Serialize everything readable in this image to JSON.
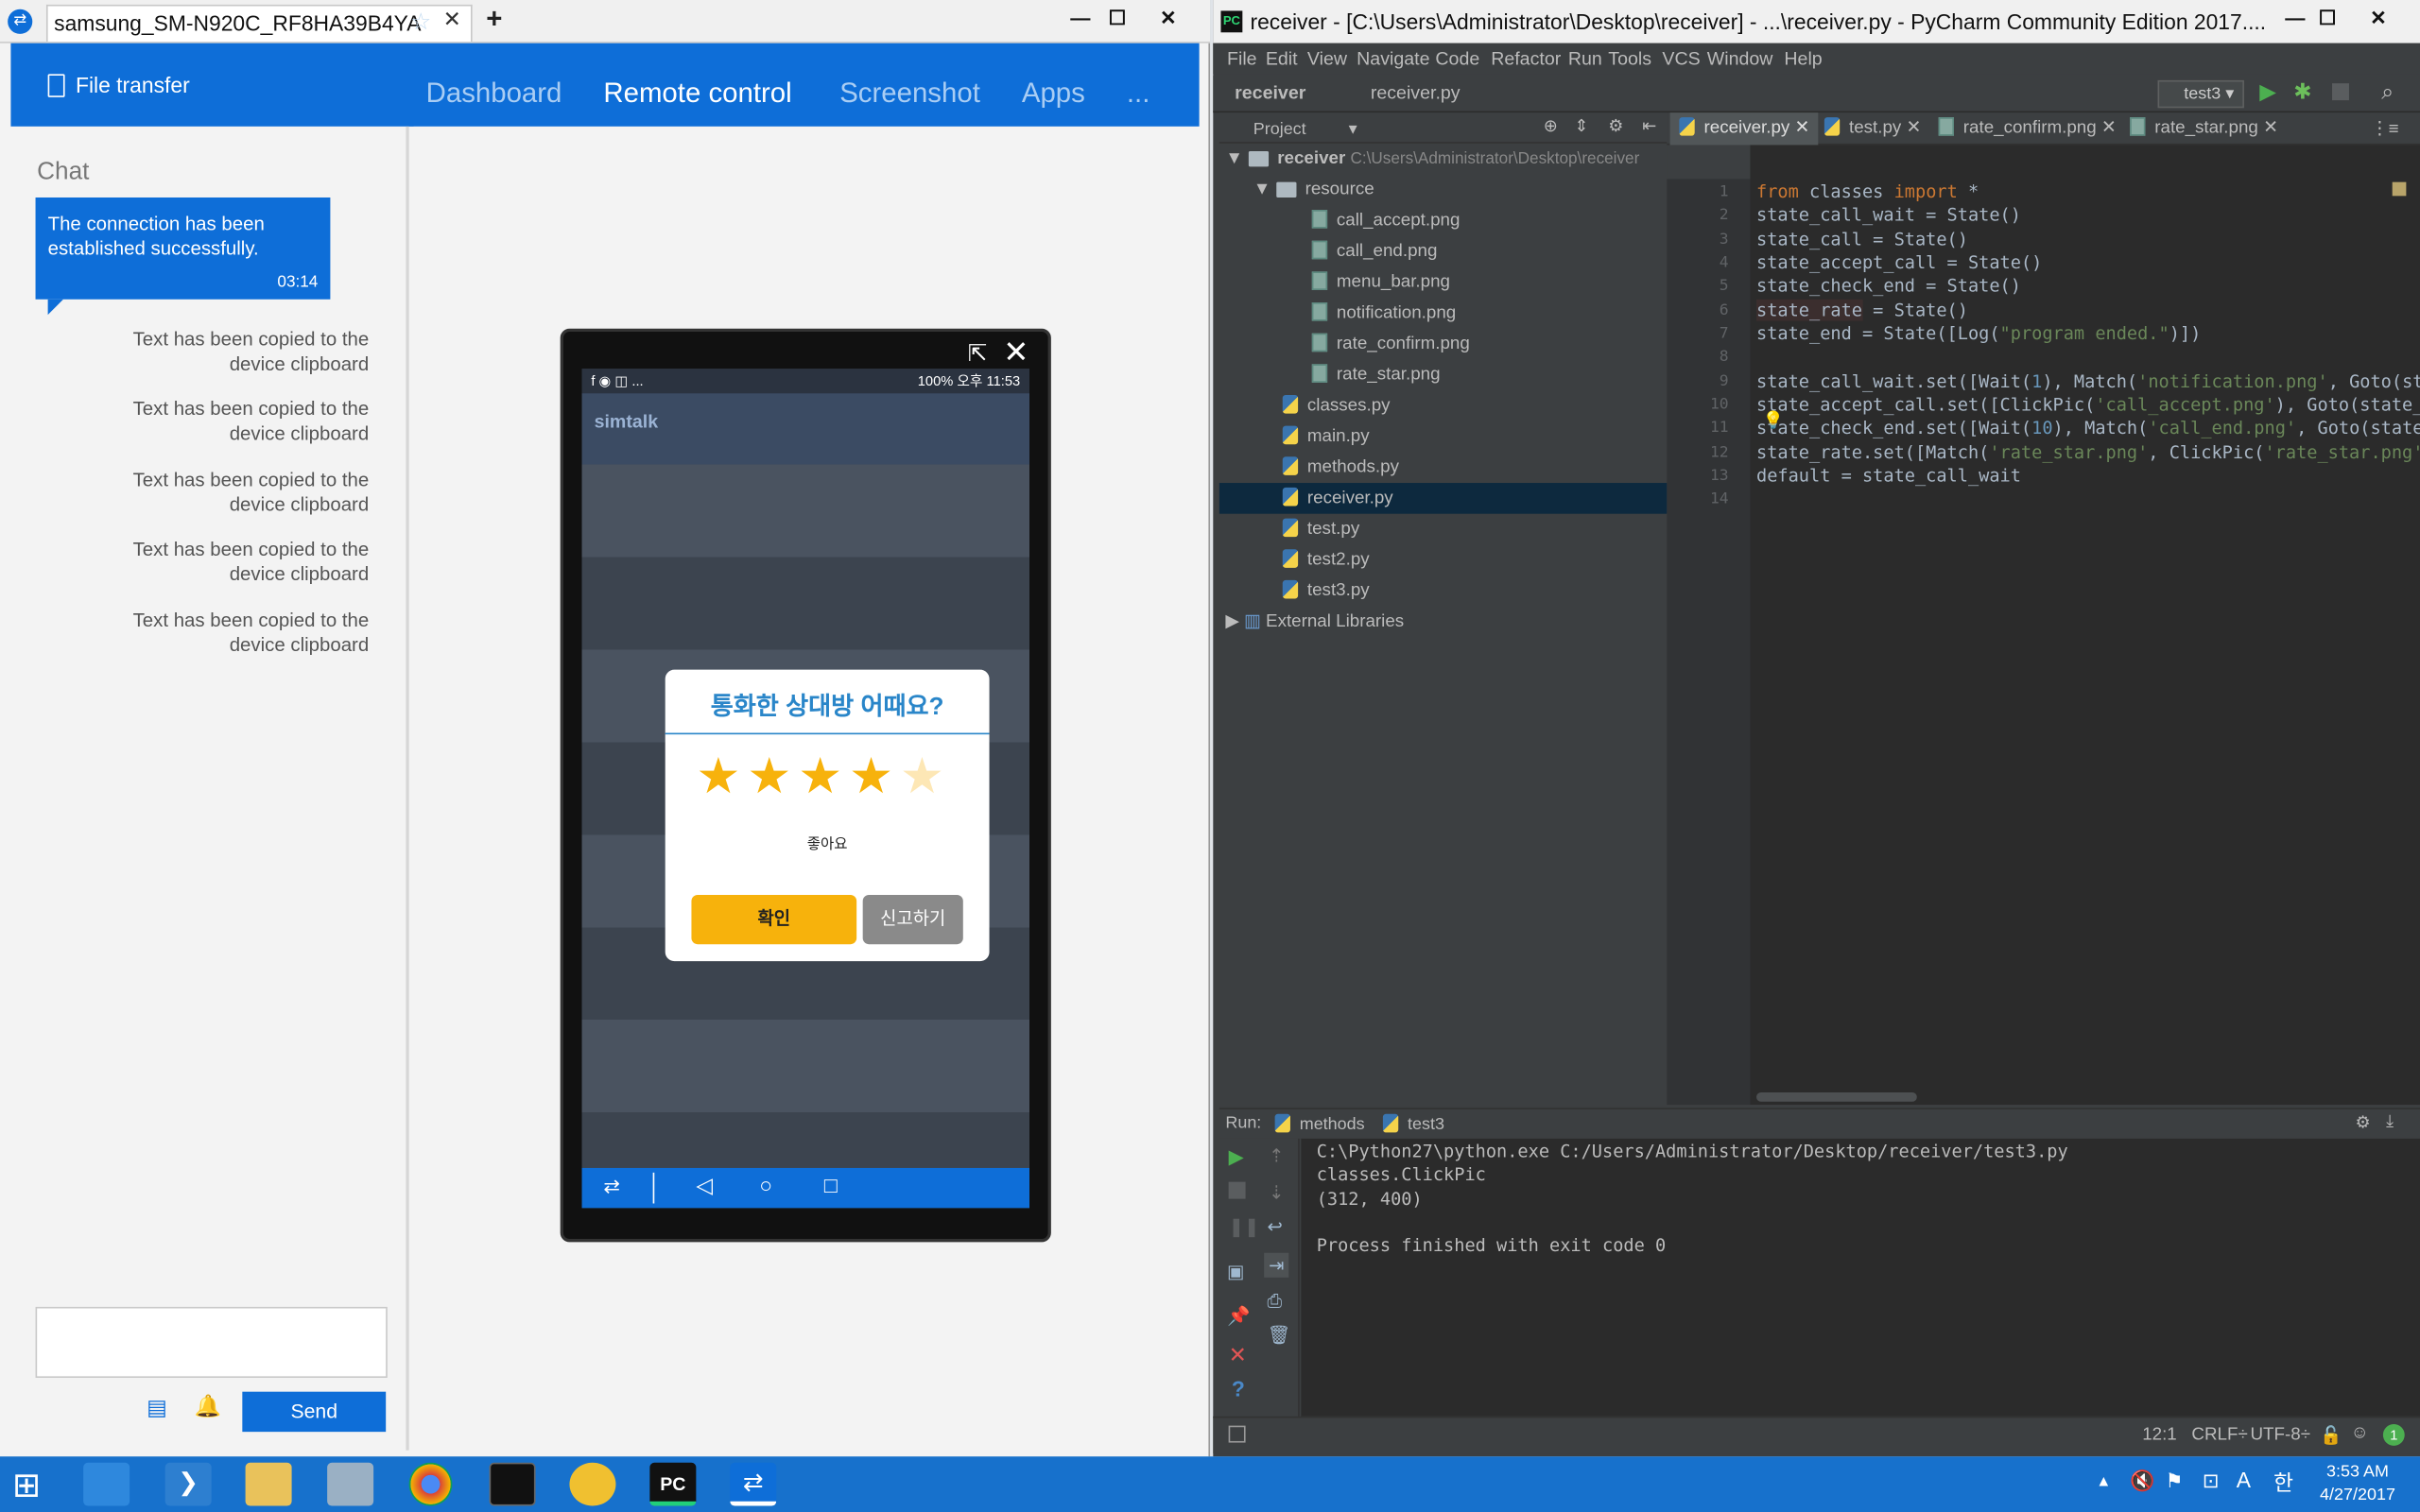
{
  "teamviewer": {
    "tab_title": "samsung_SM-N920C_RF8HA39B4YA",
    "header": {
      "file_transfer": "File transfer",
      "nav": [
        "Dashboard",
        "Remote control",
        "Screenshot",
        "Apps",
        "..."
      ]
    },
    "chat": {
      "title": "Chat",
      "bubble_text": "The connection has been established successfully.",
      "bubble_time": "03:14",
      "system_messages": [
        "Text has been copied to the device clipboard",
        "Text has been copied to the device clipboard",
        "Text has been copied to the device clipboard",
        "Text has been copied to the device clipboard",
        "Text has been copied to the device clipboard"
      ],
      "input_value": "",
      "send_label": "Send"
    },
    "phone": {
      "status_left": "f ◉ ◫ ...",
      "status_right": "100% 오후 11:53",
      "app_logo": "simtalk",
      "dialog": {
        "title": "통화한 상대방 어때요?",
        "rating": 4,
        "max_rating": 5,
        "rating_label": "좋아요",
        "confirm_label": "확인",
        "report_label": "신고하기"
      }
    }
  },
  "pycharm": {
    "title": "receiver - [C:\\Users\\Administrator\\Desktop\\receiver] - ...\\receiver.py - PyCharm Community Edition 2017....",
    "menu": [
      "File",
      "Edit",
      "View",
      "Navigate",
      "Code",
      "Refactor",
      "Run",
      "Tools",
      "VCS",
      "Window",
      "Help"
    ],
    "breadcrumb": [
      "receiver",
      "receiver.py"
    ],
    "run_config": "test3",
    "project_label": "Project",
    "tree": {
      "root": "receiver",
      "root_path": "C:\\Users\\Administrator\\Desktop\\receiver",
      "resource_folder": "resource",
      "resource_files": [
        "call_accept.png",
        "call_end.png",
        "menu_bar.png",
        "notification.png",
        "rate_confirm.png",
        "rate_star.png"
      ],
      "py_files": [
        "classes.py",
        "main.py",
        "methods.py",
        "receiver.py",
        "test.py",
        "test2.py",
        "test3.py"
      ],
      "selected": "receiver.py",
      "external": "External Libraries"
    },
    "editor_tabs": [
      "receiver.py",
      "test.py",
      "rate_confirm.png",
      "rate_star.png"
    ],
    "active_tab": "receiver.py",
    "line_numbers": [
      "1",
      "2",
      "3",
      "4",
      "5",
      "6",
      "7",
      "8",
      "9",
      "10",
      "11",
      "12",
      "13",
      "14"
    ],
    "code": {
      "l1_kw1": "from",
      "l1_mid": " classes ",
      "l1_kw2": "import",
      "l1_end": " *",
      "l2": "state_call_wait = State()",
      "l3": "state_call = State()",
      "l4": "state_accept_call = State()",
      "l5": "state_check_end = State()",
      "l6a": "state_rate",
      "l6b": " = State()",
      "l7a": "state_end = State([Log(",
      "l7s": "\"program ended.\"",
      "l7b": ")])",
      "l9a": "state_call_wait.set([Wait(",
      "l9n": "1",
      "l9b": "), Match(",
      "l9s": "'notification.png'",
      "l9c": ", Goto(st",
      "l10a": "state_accept_call.set([ClickPic(",
      "l10s": "'call_accept.png'",
      "l10b": "), Goto(state_",
      "l11a": "state_check_end.set([Wait(",
      "l11n": "10",
      "l11b": "), Match(",
      "l11s": "'call_end.png'",
      "l11c": ", Goto(state",
      "l12a": "state_rate.set([Match(",
      "l12s": "'rate_star.png'",
      "l12b": ", ClickPic(",
      "l12s2": "'rate_star.png'",
      "l13": "default = state_call_wait"
    },
    "run": {
      "label": "Run:",
      "tabs": [
        "methods",
        "test3"
      ],
      "output": [
        "C:\\Python27\\python.exe C:/Users/Administrator/Desktop/receiver/test3.py",
        "classes.ClickPic",
        "(312, 400)",
        "",
        "Process finished with exit code 0"
      ]
    },
    "status": {
      "position": "12:1",
      "line_sep": "CRLF",
      "encoding": "UTF-8"
    }
  },
  "taskbar": {
    "time": "3:53 AM",
    "date": "4/27/2017"
  },
  "colors": {
    "teamviewer_blue": "#0e6ed8",
    "star": "#f7b20c",
    "pycharm_bg": "#2b2b2b"
  }
}
